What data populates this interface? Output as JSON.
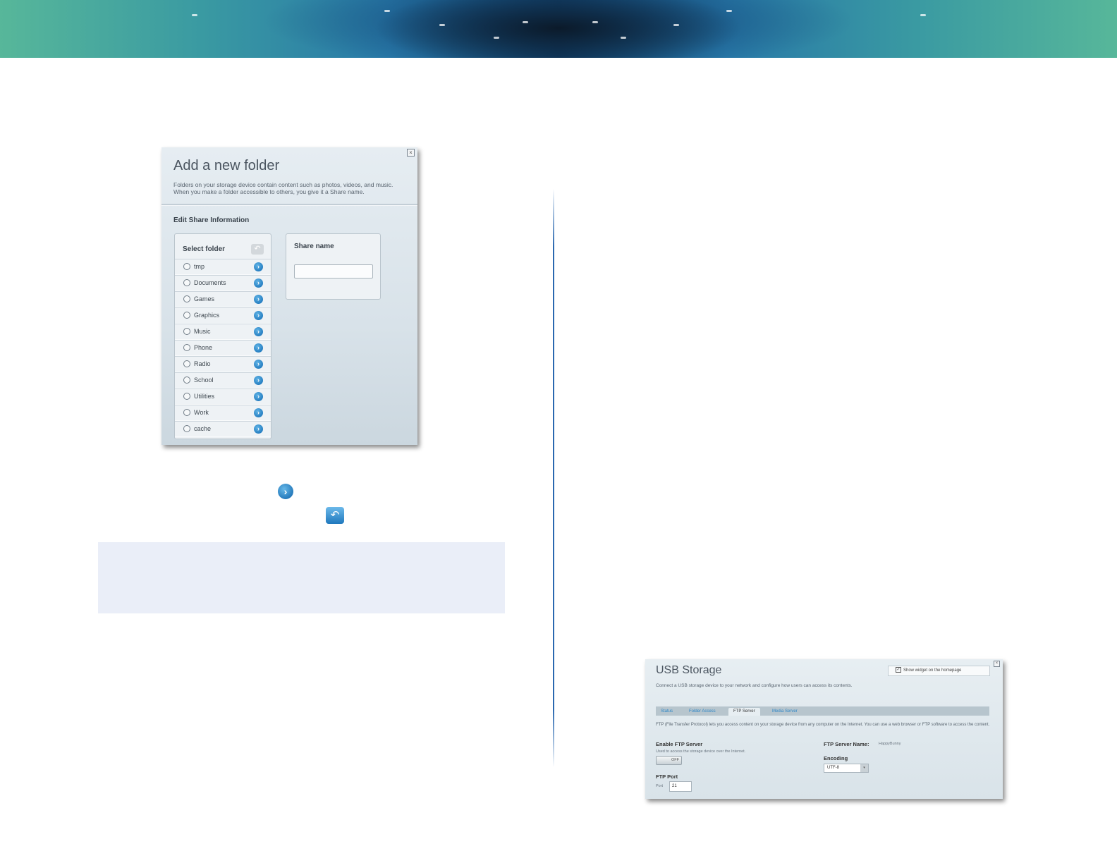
{
  "add_folder_dialog": {
    "title": "Add a new folder",
    "description": "Folders on your storage device contain content such as photos, videos, and music. When you make a folder accessible to others, you give it a Share name.",
    "close_glyph": "×",
    "section_title": "Edit Share Information",
    "select_folder_label": "Select folder",
    "share_name_label": "Share name",
    "share_name_value": "",
    "folders": [
      {
        "label": "tmp"
      },
      {
        "label": "Documents"
      },
      {
        "label": "Games"
      },
      {
        "label": "Graphics"
      },
      {
        "label": "Music"
      },
      {
        "label": "Phone"
      },
      {
        "label": "Radio"
      },
      {
        "label": "School"
      },
      {
        "label": "Utilities"
      },
      {
        "label": "Work"
      },
      {
        "label": "cache"
      }
    ]
  },
  "icons": {
    "open_folder": "chevron-right-circle-icon",
    "back": "back-arrow-icon"
  },
  "usb_storage_dialog": {
    "title": "USB Storage",
    "description": "Connect a USB storage device to your network and configure how users can access its contents.",
    "close_glyph": "×",
    "show_widget_label": "Show widget on the homepage",
    "show_widget_checked": true,
    "tabs": [
      {
        "label": "Status",
        "active": false
      },
      {
        "label": "Folder Access",
        "active": false
      },
      {
        "label": "FTP Server",
        "active": true
      },
      {
        "label": "Media Server",
        "active": false
      }
    ],
    "intro": "FTP (File Transfer Protocol) lets you access content on your storage device from any computer on the Internet. You can use a web browser or FTP software to access the content.",
    "enable_ftp_label": "Enable FTP Server",
    "enable_ftp_hint": "Used to access the storage device over the Internet.",
    "toggle_state": "OFF",
    "ftp_port_label": "FTP Port",
    "port_label": "Port",
    "port_value": "21",
    "server_name_label": "FTP Server Name:",
    "server_name_value": "HappyBunny",
    "encoding_label": "Encoding",
    "encoding_value": "UTF-8"
  },
  "colors": {
    "accent": "#1f78bd",
    "divider": "#2a68b0",
    "note_bg": "#eaeef8"
  }
}
